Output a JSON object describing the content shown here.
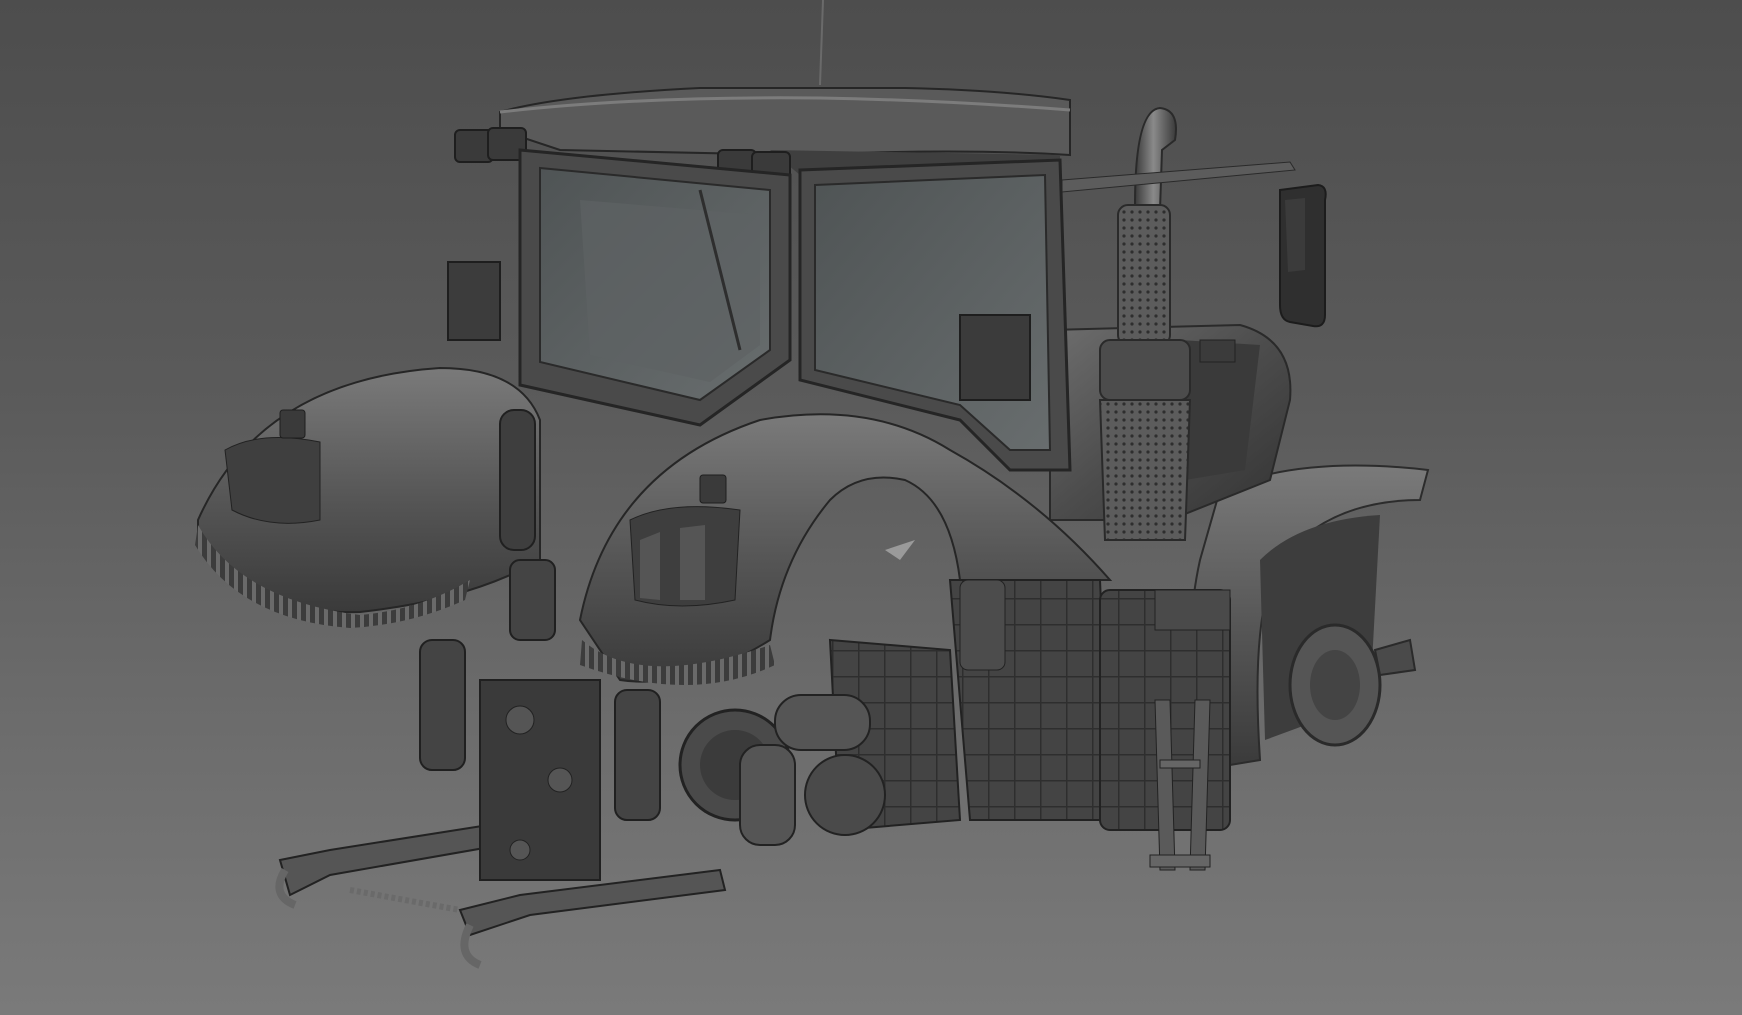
{
  "viewport": {
    "background_top": "#4d4d4d",
    "background_bottom": "#7a7a7a"
  },
  "model": {
    "subject": "tractor",
    "material": "clay-grey",
    "color_base": "#4a4a4a",
    "color_highlight": "#7d7d7d",
    "color_shadow": "#2c2c2c",
    "glass_color": "#5c6162"
  }
}
